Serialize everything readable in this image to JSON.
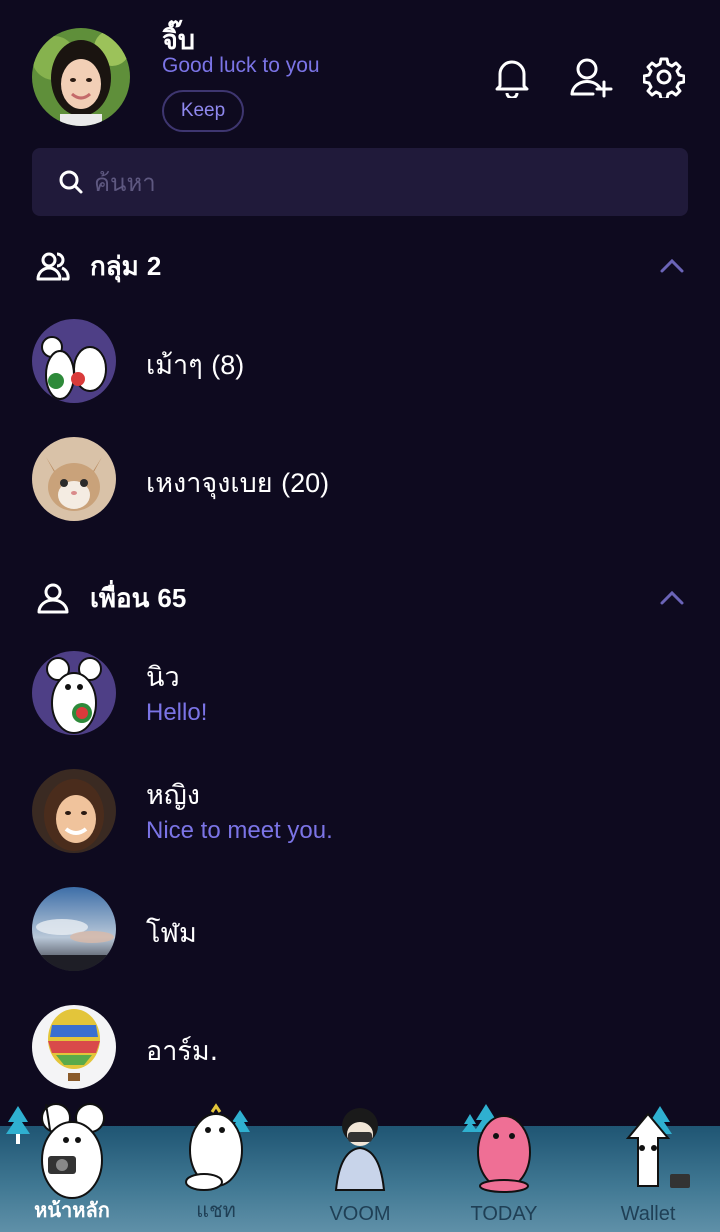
{
  "profile": {
    "name": "จิ๊บ",
    "status_message": "Good luck to you",
    "keep_label": "Keep"
  },
  "header_icons": [
    "bell-icon",
    "add-friend-icon",
    "gear-icon"
  ],
  "search": {
    "placeholder": "ค้นหา"
  },
  "groups": {
    "title": "กลุ่ม",
    "count": "2",
    "items": [
      {
        "name": "เม้าๆ",
        "count": "(8)",
        "avatar": "mouse-sticker"
      },
      {
        "name": "เหงาจุงเบย",
        "count": "(20)",
        "avatar": "cat-photo"
      }
    ]
  },
  "friends": {
    "title": "เพื่อน",
    "count": "65",
    "items": [
      {
        "name": "นิว",
        "status": "Hello!",
        "avatar": "mouse-watermelon"
      },
      {
        "name": "หญิง",
        "status": "Nice to meet you.",
        "avatar": "woman-photo"
      },
      {
        "name": "โฬม",
        "status": "",
        "avatar": "sky-photo"
      },
      {
        "name": "อาร์ม.",
        "status": "",
        "avatar": "balloon-photo"
      }
    ]
  },
  "bottom_nav": {
    "items": [
      {
        "label": "หน้าหลัก",
        "active": true
      },
      {
        "label": "แชท",
        "active": false
      },
      {
        "label": "VOOM",
        "active": false
      },
      {
        "label": "TODAY",
        "active": false
      },
      {
        "label": "Wallet",
        "active": false
      }
    ]
  },
  "colors": {
    "background": "#0e0a1f",
    "accent": "#7b74e6",
    "search_bg": "#201a3a",
    "nav_bg": "#3f7792"
  }
}
